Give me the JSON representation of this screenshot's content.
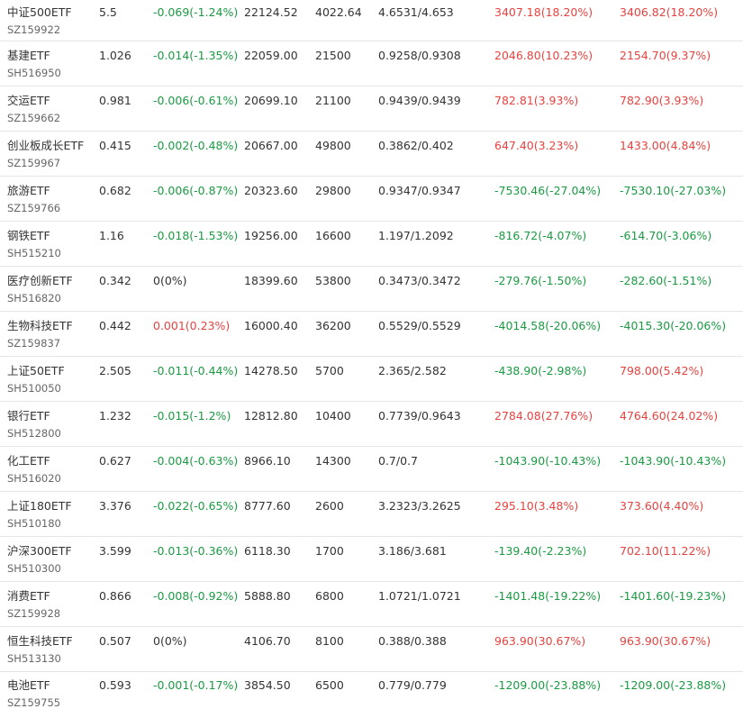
{
  "colors": {
    "up": "#e64340",
    "down": "#1b9a43",
    "flat": "#333333",
    "text": "#333333",
    "code": "#666666",
    "row_divider": "#e6e6e6"
  },
  "rows": [
    {
      "name": "中证500ETF",
      "code": "SZ159922",
      "price": "5.5",
      "change": "-0.069(-1.24%)",
      "change_dir": "down",
      "volume": "22124.52",
      "shares": "4022.64",
      "cost": "4.6531/4.653",
      "pnl1": "3407.18(18.20%)",
      "pnl1_dir": "up",
      "pnl2": "3406.82(18.20%)",
      "pnl2_dir": "up"
    },
    {
      "name": "基建ETF",
      "code": "SH516950",
      "price": "1.026",
      "change": "-0.014(-1.35%)",
      "change_dir": "down",
      "volume": "22059.00",
      "shares": "21500",
      "cost": "0.9258/0.9308",
      "pnl1": "2046.80(10.23%)",
      "pnl1_dir": "up",
      "pnl2": "2154.70(9.37%)",
      "pnl2_dir": "up"
    },
    {
      "name": "交运ETF",
      "code": "SZ159662",
      "price": "0.981",
      "change": "-0.006(-0.61%)",
      "change_dir": "down",
      "volume": "20699.10",
      "shares": "21100",
      "cost": "0.9439/0.9439",
      "pnl1": "782.81(3.93%)",
      "pnl1_dir": "up",
      "pnl2": "782.90(3.93%)",
      "pnl2_dir": "up"
    },
    {
      "name": "创业板成长ETF",
      "code": "SZ159967",
      "price": "0.415",
      "change": "-0.002(-0.48%)",
      "change_dir": "down",
      "volume": "20667.00",
      "shares": "49800",
      "cost": "0.3862/0.402",
      "pnl1": "647.40(3.23%)",
      "pnl1_dir": "up",
      "pnl2": "1433.00(4.84%)",
      "pnl2_dir": "up"
    },
    {
      "name": "旅游ETF",
      "code": "SZ159766",
      "price": "0.682",
      "change": "-0.006(-0.87%)",
      "change_dir": "down",
      "volume": "20323.60",
      "shares": "29800",
      "cost": "0.9347/0.9347",
      "pnl1": "-7530.46(-27.04%)",
      "pnl1_dir": "down",
      "pnl2": "-7530.10(-27.03%)",
      "pnl2_dir": "down"
    },
    {
      "name": "钢铁ETF",
      "code": "SH515210",
      "price": "1.16",
      "change": "-0.018(-1.53%)",
      "change_dir": "down",
      "volume": "19256.00",
      "shares": "16600",
      "cost": "1.197/1.2092",
      "pnl1": "-816.72(-4.07%)",
      "pnl1_dir": "down",
      "pnl2": "-614.70(-3.06%)",
      "pnl2_dir": "down"
    },
    {
      "name": "医疗创新ETF",
      "code": "SH516820",
      "price": "0.342",
      "change": "0(0%)",
      "change_dir": "flat",
      "volume": "18399.60",
      "shares": "53800",
      "cost": "0.3473/0.3472",
      "pnl1": "-279.76(-1.50%)",
      "pnl1_dir": "down",
      "pnl2": "-282.60(-1.51%)",
      "pnl2_dir": "down"
    },
    {
      "name": "生物科技ETF",
      "code": "SZ159837",
      "price": "0.442",
      "change": "0.001(0.23%)",
      "change_dir": "up",
      "volume": "16000.40",
      "shares": "36200",
      "cost": "0.5529/0.5529",
      "pnl1": "-4014.58(-20.06%)",
      "pnl1_dir": "down",
      "pnl2": "-4015.30(-20.06%)",
      "pnl2_dir": "down"
    },
    {
      "name": "上证50ETF",
      "code": "SH510050",
      "price": "2.505",
      "change": "-0.011(-0.44%)",
      "change_dir": "down",
      "volume": "14278.50",
      "shares": "5700",
      "cost": "2.365/2.582",
      "pnl1": "-438.90(-2.98%)",
      "pnl1_dir": "down",
      "pnl2": "798.00(5.42%)",
      "pnl2_dir": "up"
    },
    {
      "name": "银行ETF",
      "code": "SH512800",
      "price": "1.232",
      "change": "-0.015(-1.2%)",
      "change_dir": "down",
      "volume": "12812.80",
      "shares": "10400",
      "cost": "0.7739/0.9643",
      "pnl1": "2784.08(27.76%)",
      "pnl1_dir": "up",
      "pnl2": "4764.60(24.02%)",
      "pnl2_dir": "up"
    },
    {
      "name": "化工ETF",
      "code": "SH516020",
      "price": "0.627",
      "change": "-0.004(-0.63%)",
      "change_dir": "down",
      "volume": "8966.10",
      "shares": "14300",
      "cost": "0.7/0.7",
      "pnl1": "-1043.90(-10.43%)",
      "pnl1_dir": "down",
      "pnl2": "-1043.90(-10.43%)",
      "pnl2_dir": "down"
    },
    {
      "name": "上证180ETF",
      "code": "SH510180",
      "price": "3.376",
      "change": "-0.022(-0.65%)",
      "change_dir": "down",
      "volume": "8777.60",
      "shares": "2600",
      "cost": "3.2323/3.2625",
      "pnl1": "295.10(3.48%)",
      "pnl1_dir": "up",
      "pnl2": "373.60(4.40%)",
      "pnl2_dir": "up"
    },
    {
      "name": "沪深300ETF",
      "code": "SH510300",
      "price": "3.599",
      "change": "-0.013(-0.36%)",
      "change_dir": "down",
      "volume": "6118.30",
      "shares": "1700",
      "cost": "3.186/3.681",
      "pnl1": "-139.40(-2.23%)",
      "pnl1_dir": "down",
      "pnl2": "702.10(11.22%)",
      "pnl2_dir": "up"
    },
    {
      "name": "消费ETF",
      "code": "SZ159928",
      "price": "0.866",
      "change": "-0.008(-0.92%)",
      "change_dir": "down",
      "volume": "5888.80",
      "shares": "6800",
      "cost": "1.0721/1.0721",
      "pnl1": "-1401.48(-19.22%)",
      "pnl1_dir": "down",
      "pnl2": "-1401.60(-19.23%)",
      "pnl2_dir": "down"
    },
    {
      "name": "恒生科技ETF",
      "code": "SH513130",
      "price": "0.507",
      "change": "0(0%)",
      "change_dir": "flat",
      "volume": "4106.70",
      "shares": "8100",
      "cost": "0.388/0.388",
      "pnl1": "963.90(30.67%)",
      "pnl1_dir": "up",
      "pnl2": "963.90(30.67%)",
      "pnl2_dir": "up"
    },
    {
      "name": "电池ETF",
      "code": "SZ159755",
      "price": "0.593",
      "change": "-0.001(-0.17%)",
      "change_dir": "down",
      "volume": "3854.50",
      "shares": "6500",
      "cost": "0.779/0.779",
      "pnl1": "-1209.00(-23.88%)",
      "pnl1_dir": "down",
      "pnl2": "-1209.00(-23.88%)",
      "pnl2_dir": "down"
    }
  ]
}
